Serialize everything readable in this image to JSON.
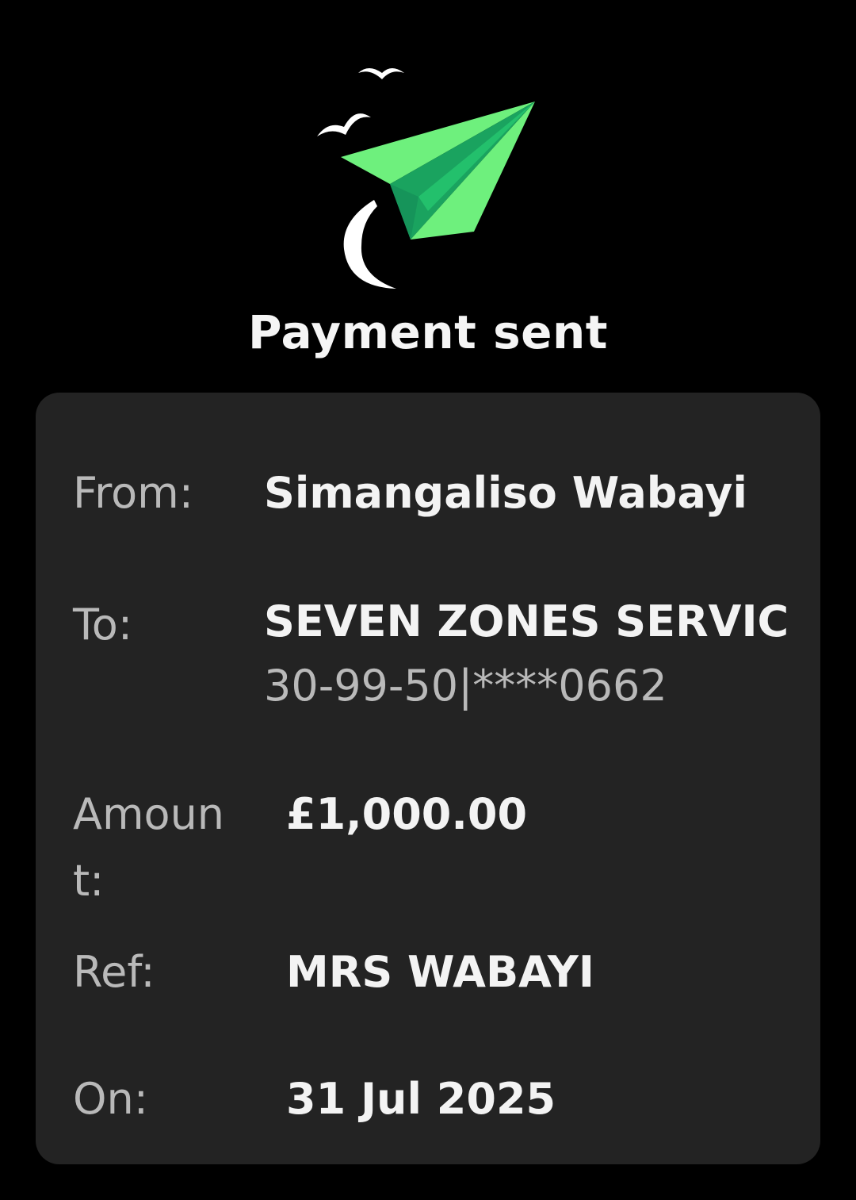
{
  "header": {
    "title": "Payment sent",
    "illustration_icon": "paper-plane-with-birds-icon",
    "accent_color": "#6ef07d"
  },
  "details": {
    "from_label": "From:",
    "from_value": "Simangaliso Wabayi",
    "to_label": "To:",
    "to_value": "SEVEN ZONES SERVIC",
    "to_account": "30-99-50|****0662",
    "amount_label_line1": "Amoun",
    "amount_label_line2": "t:",
    "amount_value": "£1,000.00",
    "ref_label": "Ref:",
    "ref_value": "MRS WABAYI",
    "on_label": "On:",
    "on_value": "31 Jul 2025"
  }
}
